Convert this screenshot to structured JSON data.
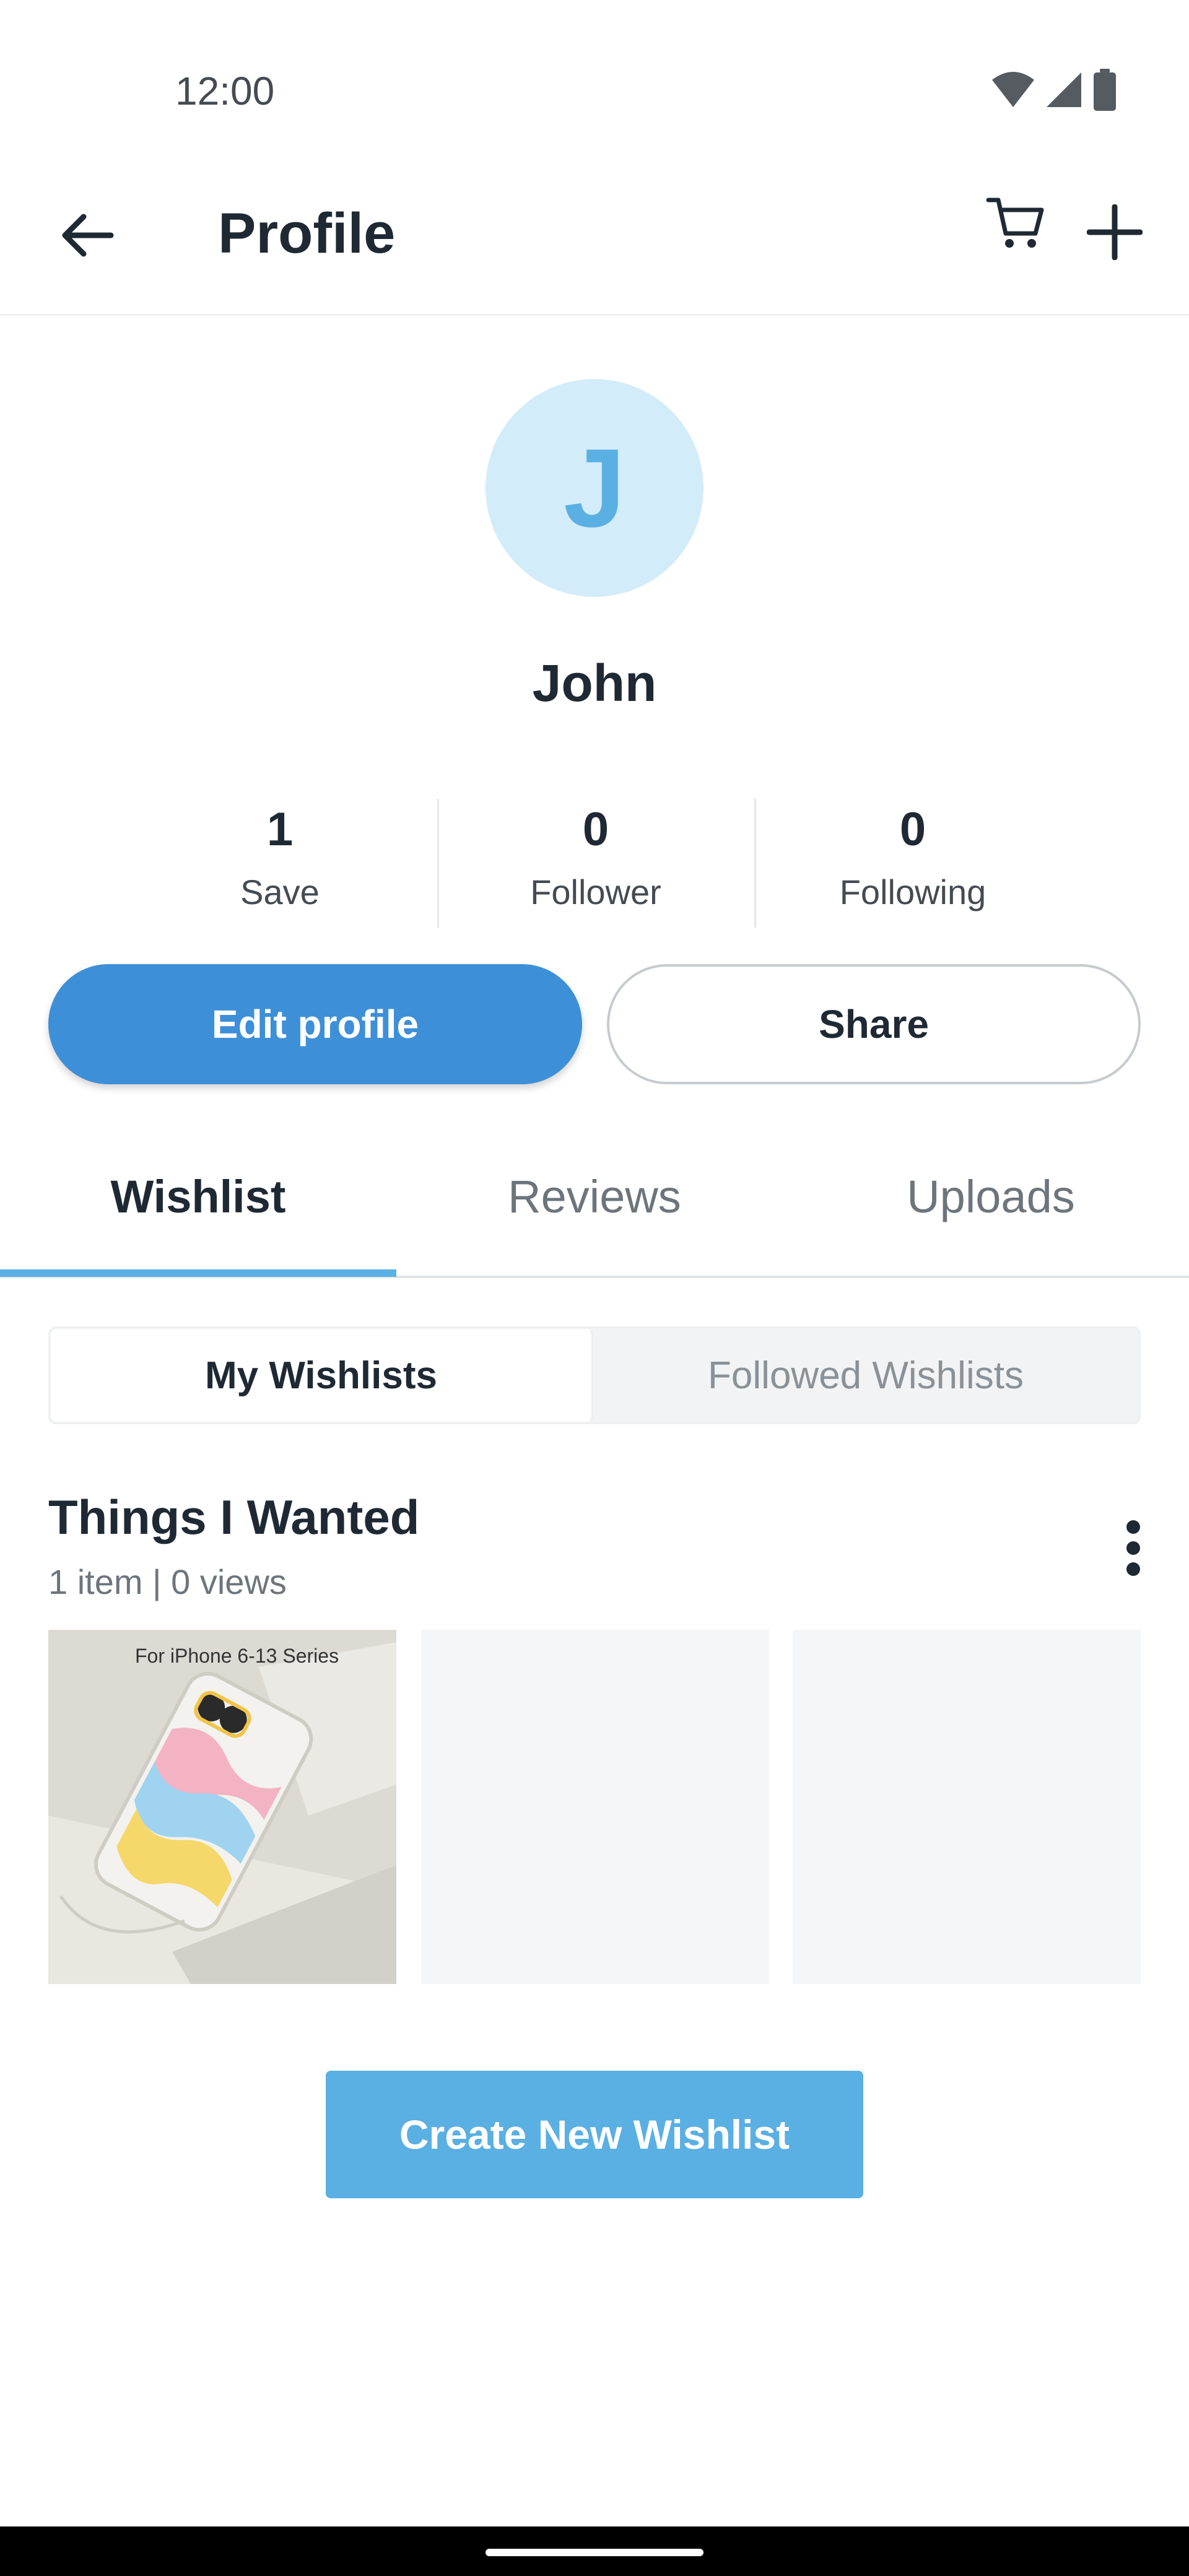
{
  "status_bar": {
    "time": "12:00"
  },
  "app_bar": {
    "title": "Profile",
    "icons": [
      "arrow-back-icon",
      "cart-icon",
      "plus-icon"
    ]
  },
  "profile": {
    "avatar_initial": "J",
    "name": "John",
    "avatar_bg": "#d3ecf9",
    "avatar_fg": "#5aafe3"
  },
  "stats": [
    {
      "value": "1",
      "label": "Save"
    },
    {
      "value": "0",
      "label": "Follower"
    },
    {
      "value": "0",
      "label": "Following"
    }
  ],
  "actions": {
    "edit_profile": "Edit profile",
    "share": "Share",
    "primary_color": "#3d8fd8"
  },
  "tabs": [
    {
      "label": "Wishlist",
      "active": true
    },
    {
      "label": "Reviews",
      "active": false
    },
    {
      "label": "Uploads",
      "active": false
    }
  ],
  "segmented": {
    "options": [
      "My Wishlists",
      "Followed Wishlists"
    ],
    "selected": "My Wishlists"
  },
  "wishlist": {
    "title": "Things I Wanted",
    "meta": "1 item | 0 views",
    "product_image_text": "For iPhone 6-13 Series"
  },
  "create_button": "Create New Wishlist",
  "accent_color": "#5aafe3"
}
